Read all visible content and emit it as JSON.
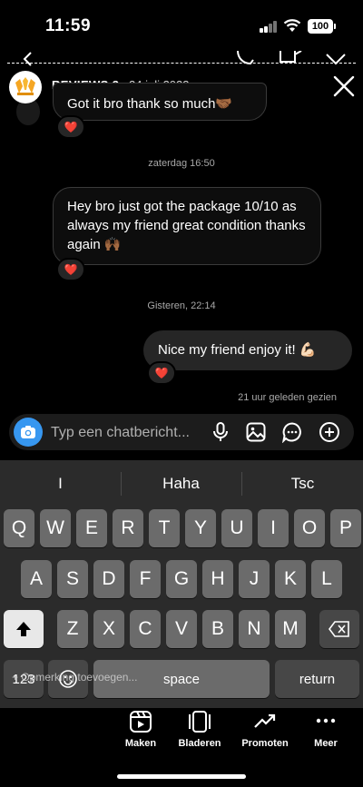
{
  "status": {
    "time": "11:59",
    "battery": "100"
  },
  "header": {
    "name": "REVIEWS 3",
    "date": "24 juli 2023"
  },
  "messages": [
    {
      "text": "Got it bro thank so much🤝🏾",
      "reaction": "❤️"
    },
    {
      "text": "Hey bro just got the package 10/10 as always my friend great condition thanks again 🙌🏾",
      "reaction": "❤️"
    },
    {
      "text": "Nice my friend enjoy it! 💪🏻",
      "reaction": "❤️"
    }
  ],
  "timestamps": {
    "first": "zaterdag 16:50",
    "second": "Gisteren, 22:14"
  },
  "seen": "21 uur geleden gezien",
  "composer": {
    "placeholder": "Typ een chatbericht..."
  },
  "keyboard": {
    "suggestions": [
      "I",
      "Haha",
      "Tsc"
    ],
    "row1": [
      "Q",
      "W",
      "E",
      "R",
      "T",
      "Y",
      "U",
      "I",
      "O",
      "P"
    ],
    "row2": [
      "A",
      "S",
      "D",
      "F",
      "G",
      "H",
      "J",
      "K",
      "L"
    ],
    "row3": [
      "Z",
      "X",
      "C",
      "V",
      "B",
      "N",
      "M"
    ],
    "numbers": "123",
    "space": "space",
    "return": "return",
    "overlay": "+ Opmerking toevoegen..."
  },
  "bottom_nav": [
    {
      "label": "Maken"
    },
    {
      "label": "Bladeren"
    },
    {
      "label": "Promoten"
    },
    {
      "label": "Meer"
    }
  ],
  "colors": {
    "accent": "#3797f0",
    "heart": "#ff3040"
  }
}
